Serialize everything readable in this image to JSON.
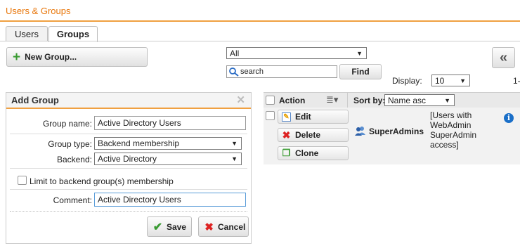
{
  "header": {
    "title": "Users & Groups"
  },
  "tabs": [
    {
      "label": "Users"
    },
    {
      "label": "Groups"
    }
  ],
  "toolbar": {
    "new_group_label": "New Group...",
    "filter_value": "All",
    "search_placeholder": "search",
    "find_label": "Find",
    "display_label": "Display:",
    "display_value": "10",
    "first_page_glyph": "«",
    "range_text": "1-"
  },
  "add_group": {
    "title": "Add Group",
    "group_name_label": "Group name:",
    "group_name_value": "Active Directory Users",
    "group_type_label": "Group type:",
    "group_type_value": "Backend membership",
    "backend_label": "Backend:",
    "backend_value": "Active Directory",
    "limit_label": "Limit to backend group(s) membership",
    "comment_label": "Comment:",
    "comment_value": "Active Directory Users",
    "save_label": "Save",
    "cancel_label": "Cancel"
  },
  "grid": {
    "action_header": "Action",
    "sort_by_label": "Sort by:",
    "sort_value": "Name asc",
    "rows": [
      {
        "edit_label": "Edit",
        "delete_label": "Delete",
        "clone_label": "Clone",
        "name": "SuperAdmins",
        "comment_lines": [
          "[Users with",
          "WebAdmin",
          "SuperAdmin",
          "access]"
        ]
      }
    ]
  },
  "colors": {
    "accent": "#e8760a",
    "accent_line": "#f0a040",
    "plus_green": "#3a9b32",
    "delete_red": "#d22",
    "info_blue": "#1a6fc8"
  }
}
